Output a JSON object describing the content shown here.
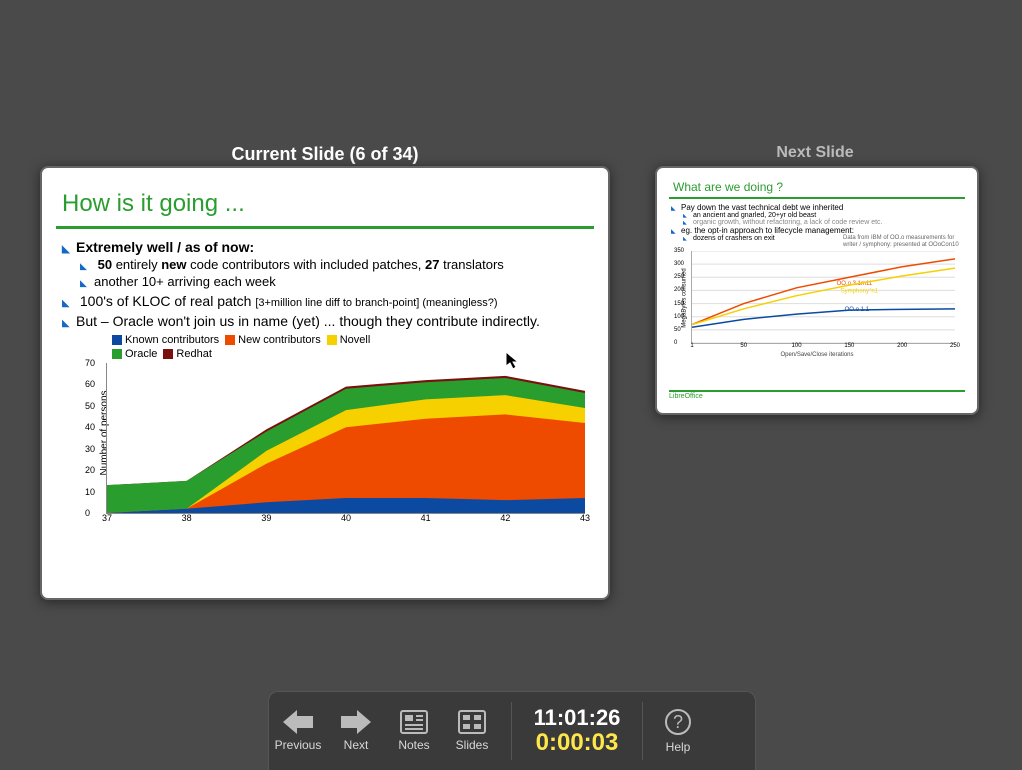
{
  "labels": {
    "current": "Current Slide (6 of 34)",
    "next": "Next Slide"
  },
  "toolbar": {
    "previous": "Previous",
    "next": "Next",
    "notes": "Notes",
    "slides": "Slides",
    "help": "Help",
    "clock": "11:01:26",
    "elapsed": "0:00:03"
  },
  "current_slide": {
    "title": "How is it going ...",
    "bullets": {
      "b1": "Extremely well / as of now:",
      "b2a_pre": "50",
      "b2a_mid": " entirely ",
      "b2a_new": "new",
      "b2a_post": " code contributors with included patches, ",
      "b2a_27": "27",
      "b2a_trans": " translators",
      "b2b": "another 10+ arriving each week",
      "b3_pre": "100's of KLOC of real patch ",
      "b3_small": "[3+million line diff to branch-point] (meaningless?)",
      "b4": "But – Oracle won't join us in name (yet) ... though they contribute indirectly."
    },
    "chart": {
      "ylabel": "Number of persons",
      "ymax": 70,
      "yticks": [
        0,
        10,
        20,
        30,
        40,
        50,
        60,
        70
      ],
      "xticks": [
        "37",
        "38",
        "39",
        "40",
        "41",
        "42",
        "43"
      ],
      "legend": [
        {
          "name": "Known contributors",
          "color": "#0b4aa0"
        },
        {
          "name": "New contributors",
          "color": "#ef4b00"
        },
        {
          "name": "Novell",
          "color": "#f7d000"
        },
        {
          "name": "Oracle",
          "color": "#2a9d2f"
        },
        {
          "name": "Redhat",
          "color": "#7b1010"
        }
      ]
    }
  },
  "next_slide": {
    "title": "What are we doing ?",
    "b1": "Pay down the vast technical debt we inherited",
    "b2a": "an ancient and gnarled, 20+yr old beast",
    "b2b": "organic growth, without refactoring, a lack of code review etc.",
    "b3": "eg. the opt-in approach to lifecycle management:",
    "b4": "dozens of crashers on exit",
    "caption": "Data from IBM of OO.o measurements for writer / symphony: presented at OOoCon10",
    "chart": {
      "ylabel": "MegaBytes consumed",
      "yticks": [
        0,
        50,
        100,
        150,
        200,
        250,
        300,
        350
      ],
      "xticks": [
        "1",
        "50",
        "100",
        "150",
        "200",
        "250"
      ],
      "xlabel": "Open/Save/Close iterations",
      "lines": [
        "OO.o 3.1m11",
        "Symphony*n1",
        "OO.o 1.1"
      ]
    },
    "footer": "LibreOffice"
  },
  "chart_data": [
    {
      "type": "area",
      "title": "How is it going ...",
      "xlabel": "",
      "ylabel": "Number of persons",
      "x": [
        37,
        38,
        39,
        40,
        41,
        42,
        43
      ],
      "ylim": [
        0,
        70
      ],
      "series": [
        {
          "name": "Known contributors",
          "color": "#0b4aa0",
          "values": [
            0,
            2,
            5,
            7,
            7,
            6,
            7
          ]
        },
        {
          "name": "New contributors",
          "color": "#ef4b00",
          "values": [
            0,
            0,
            18,
            33,
            37,
            40,
            35
          ]
        },
        {
          "name": "Novell",
          "color": "#f7d000",
          "values": [
            0,
            0,
            6,
            8,
            9,
            9,
            7
          ]
        },
        {
          "name": "Oracle",
          "color": "#2a9d2f",
          "values": [
            13,
            13,
            9,
            10,
            8,
            8,
            7
          ]
        },
        {
          "name": "Redhat",
          "color": "#7b1010",
          "values": [
            0,
            0,
            1,
            1,
            1,
            1,
            1
          ]
        }
      ]
    },
    {
      "type": "line",
      "title": "What are we doing ?",
      "xlabel": "Open/Save/Close iterations",
      "ylabel": "MegaBytes consumed",
      "x": [
        1,
        50,
        100,
        150,
        200,
        250
      ],
      "ylim": [
        0,
        350
      ],
      "series": [
        {
          "name": "OO.o 3.1m11",
          "color": "#ef4b00",
          "values": [
            70,
            150,
            210,
            250,
            290,
            320
          ]
        },
        {
          "name": "Symphony*n1",
          "color": "#f7d000",
          "values": [
            70,
            130,
            180,
            220,
            255,
            285
          ]
        },
        {
          "name": "OO.o 1.1",
          "color": "#0b4aa0",
          "values": [
            60,
            90,
            110,
            125,
            128,
            130
          ]
        }
      ]
    }
  ]
}
